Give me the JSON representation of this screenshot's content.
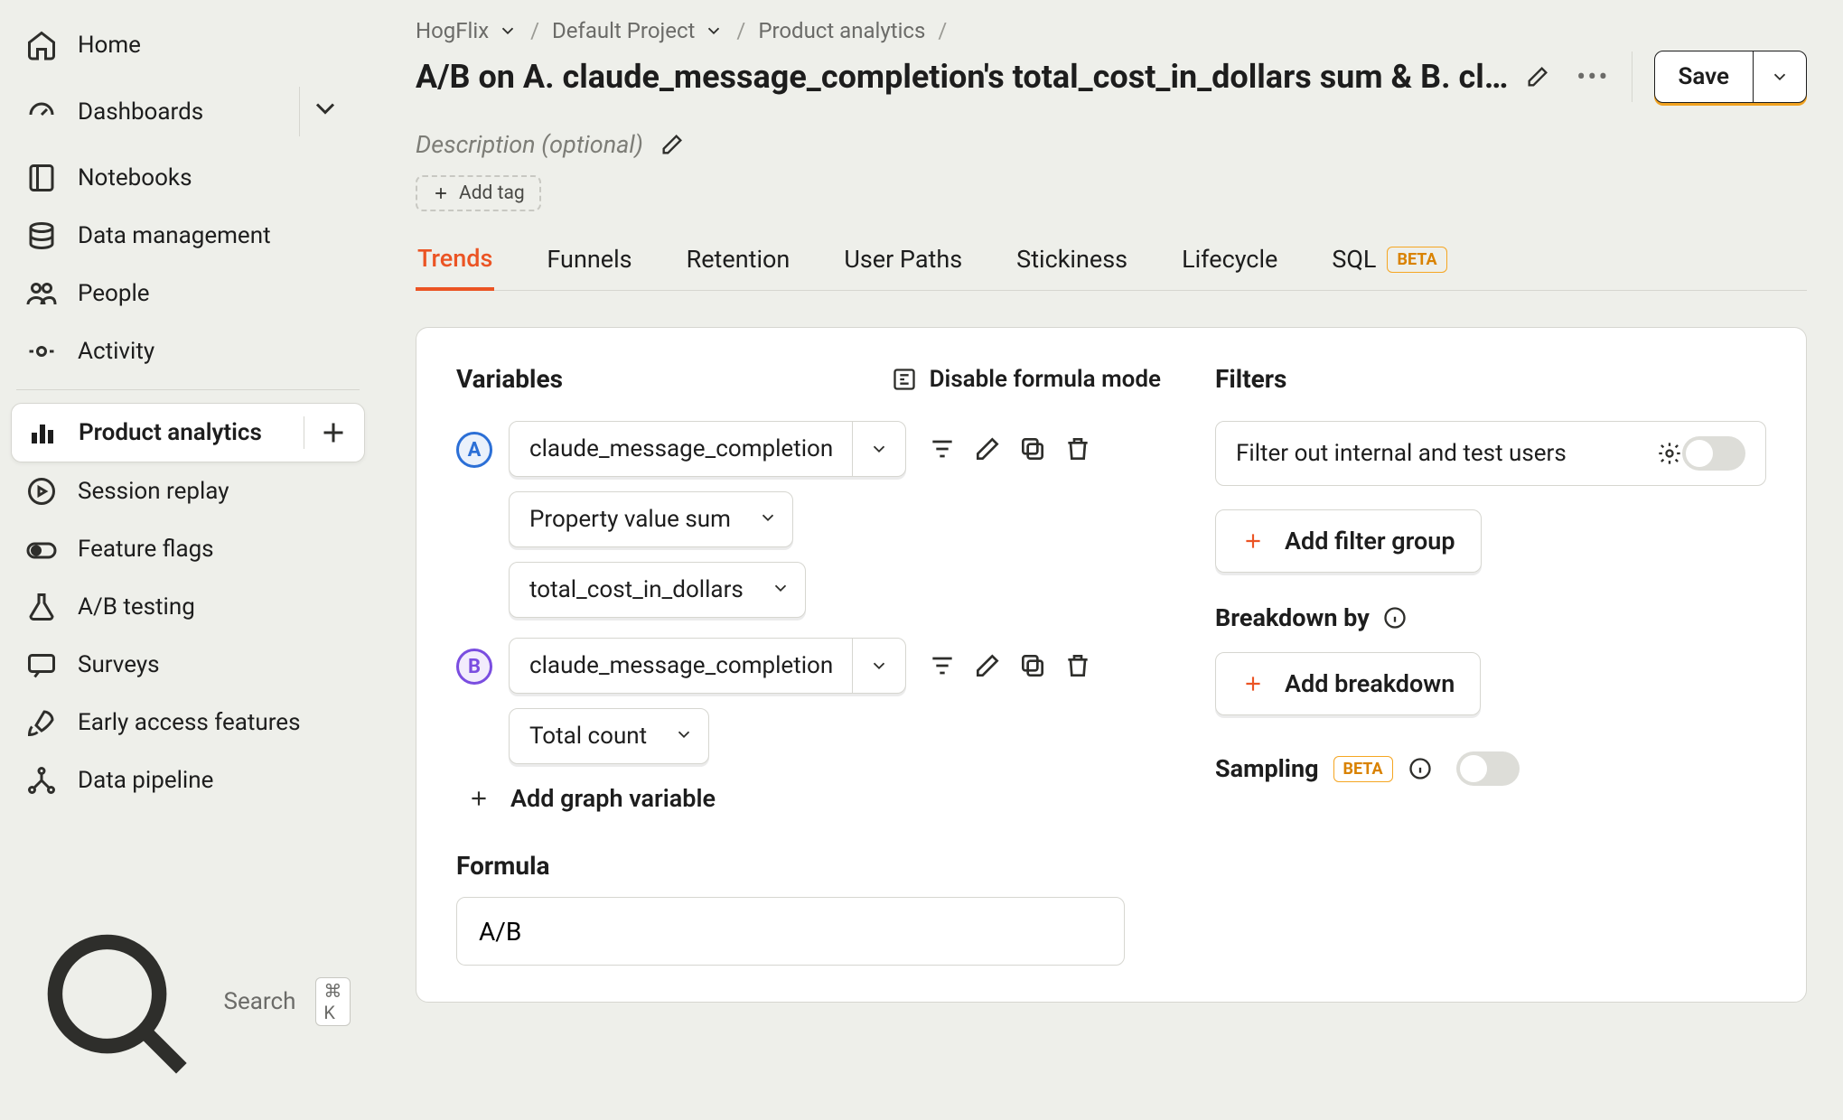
{
  "sidebar": {
    "items": [
      {
        "label": "Home"
      },
      {
        "label": "Dashboards"
      },
      {
        "label": "Notebooks"
      },
      {
        "label": "Data management"
      },
      {
        "label": "People"
      },
      {
        "label": "Activity"
      },
      {
        "label": "Product analytics"
      },
      {
        "label": "Session replay"
      },
      {
        "label": "Feature flags"
      },
      {
        "label": "A/B testing"
      },
      {
        "label": "Surveys"
      },
      {
        "label": "Early access features"
      },
      {
        "label": "Data pipeline"
      }
    ],
    "search": "Search",
    "kbd": "⌘ K"
  },
  "breadcrumbs": {
    "org": "HogFlix",
    "project": "Default Project",
    "section": "Product analytics"
  },
  "header": {
    "title": "A/B on A. claude_message_completion's total_cost_in_dollars sum & B. cla…",
    "save": "Save",
    "description_placeholder": "Description (optional)",
    "add_tag": "Add tag"
  },
  "tabs": {
    "trends": "Trends",
    "funnels": "Funnels",
    "retention": "Retention",
    "paths": "User Paths",
    "stickiness": "Stickiness",
    "lifecycle": "Lifecycle",
    "sql": "SQL",
    "beta": "BETA"
  },
  "panel": {
    "variables_title": "Variables",
    "formula_toggle": "Disable formula mode",
    "varA": {
      "event": "claude_message_completion",
      "agg": "Property value sum",
      "prop": "total_cost_in_dollars"
    },
    "varB": {
      "event": "claude_message_completion",
      "agg": "Total count"
    },
    "add_variable": "Add graph variable",
    "formula_title": "Formula",
    "formula_value": "A/B",
    "filters_title": "Filters",
    "filter_internal": "Filter out internal and test users",
    "add_filter_group": "Add filter group",
    "breakdown_title": "Breakdown by",
    "add_breakdown": "Add breakdown",
    "sampling_title": "Sampling",
    "sampling_badge": "BETA"
  }
}
